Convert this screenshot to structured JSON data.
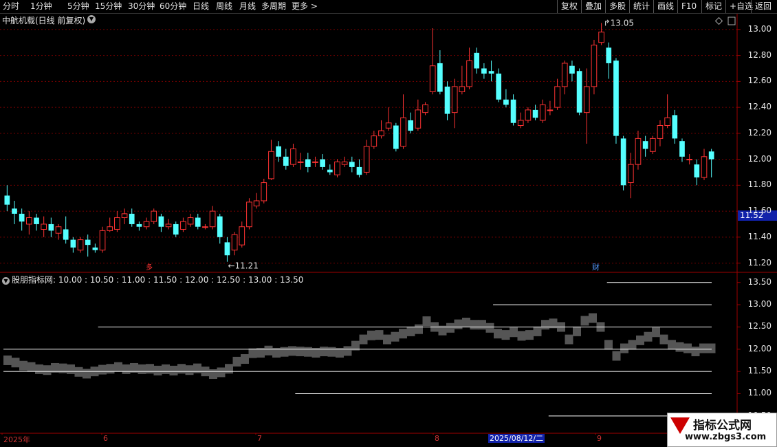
{
  "toolbar": {
    "periods": [
      "分时",
      "1分钟",
      "5分钟",
      "15分钟",
      "30分钟",
      "60分钟",
      "日线",
      "周线",
      "月线",
      "多周期",
      "更多 >"
    ],
    "active_period": "日线",
    "right_buttons": [
      "复权",
      "叠加",
      "多股",
      "统计",
      "画线",
      "F10",
      "标记",
      "+自选",
      "返回"
    ]
  },
  "main_chart": {
    "title": "中航机载(日线 前复权)",
    "current_price": "11.52",
    "price_labels": [
      "13.00",
      "12.80",
      "12.60",
      "12.40",
      "12.20",
      "12.00",
      "11.80",
      "11.60",
      "11.40",
      "11.20"
    ],
    "high_annotation": "13.05",
    "low_annotation": "11.21",
    "event_mark": "财",
    "event_mark2": "多",
    "colors": {
      "up": "#ff3333",
      "down": "#55ffff",
      "background": "#000000",
      "grid": "#7a0000"
    }
  },
  "indicator": {
    "title": "股朋指标网",
    "levels_text": ": 10.00 : 10.50 : 11.00 : 11.50 : 12.00 : 12.50 : 13.00 : 13.50",
    "axis_labels": [
      "13.50",
      "13.00",
      "12.50",
      "12.00",
      "11.50",
      "11.00",
      "10.50"
    ]
  },
  "date_axis": {
    "labels": [
      "2025年",
      "6",
      "7",
      "8",
      "9"
    ],
    "cursor": "2025/08/12/二"
  },
  "watermark": {
    "line1": "指标公式网",
    "line2": "www.zbgs3.com"
  },
  "chart_data": {
    "type": "candlestick",
    "ylim": [
      11.15,
      13.1
    ],
    "candles": [
      [
        11.72,
        11.65,
        11.8,
        11.6
      ],
      [
        11.62,
        11.58,
        11.68,
        11.5
      ],
      [
        11.58,
        11.52,
        11.62,
        11.45
      ],
      [
        11.5,
        11.55,
        11.6,
        11.42
      ],
      [
        11.55,
        11.5,
        11.58,
        11.45
      ],
      [
        11.46,
        11.5,
        11.56,
        11.4
      ],
      [
        11.5,
        11.45,
        11.55,
        11.4
      ],
      [
        11.43,
        11.48,
        11.5,
        11.38
      ],
      [
        11.46,
        11.38,
        11.56,
        11.35
      ],
      [
        11.38,
        11.32,
        11.4,
        11.28
      ],
      [
        11.3,
        11.38,
        11.4,
        11.28
      ],
      [
        11.38,
        11.34,
        11.42,
        11.25
      ],
      [
        11.32,
        11.3,
        11.35,
        11.28
      ],
      [
        11.3,
        11.45,
        11.48,
        11.28
      ],
      [
        11.45,
        11.48,
        11.55,
        11.44
      ],
      [
        11.46,
        11.55,
        11.6,
        11.44
      ],
      [
        11.55,
        11.58,
        11.62,
        11.5
      ],
      [
        11.58,
        11.5,
        11.62,
        11.48
      ],
      [
        11.5,
        11.48,
        11.52,
        11.45
      ],
      [
        11.48,
        11.52,
        11.55,
        11.46
      ],
      [
        11.52,
        11.6,
        11.62,
        11.5
      ],
      [
        11.56,
        11.48,
        11.58,
        11.44
      ],
      [
        11.48,
        11.5,
        11.54,
        11.46
      ],
      [
        11.5,
        11.42,
        11.52,
        11.4
      ],
      [
        11.46,
        11.52,
        11.55,
        11.44
      ],
      [
        11.5,
        11.55,
        11.58,
        11.48
      ],
      [
        11.55,
        11.48,
        11.58,
        11.46
      ],
      [
        11.48,
        11.48,
        11.5,
        11.46
      ],
      [
        11.48,
        11.6,
        11.64,
        11.46
      ],
      [
        11.56,
        11.4,
        11.58,
        11.35
      ],
      [
        11.36,
        11.26,
        11.4,
        11.21
      ],
      [
        11.3,
        11.42,
        11.44,
        11.26
      ],
      [
        11.34,
        11.48,
        11.52,
        11.32
      ],
      [
        11.48,
        11.67,
        11.7,
        11.46
      ],
      [
        11.64,
        11.68,
        11.74,
        11.62
      ],
      [
        11.68,
        11.82,
        11.85,
        11.66
      ],
      [
        11.85,
        12.06,
        12.15,
        11.84
      ],
      [
        12.1,
        12.02,
        12.14,
        11.98
      ],
      [
        12.02,
        11.95,
        12.08,
        11.92
      ],
      [
        11.96,
        12.08,
        12.12,
        11.94
      ],
      [
        11.98,
        11.98,
        12.05,
        11.92
      ],
      [
        12.0,
        11.94,
        12.05,
        11.9
      ],
      [
        11.98,
        11.98,
        12.02,
        11.94
      ],
      [
        12.0,
        11.94,
        12.04,
        11.92
      ],
      [
        11.92,
        11.9,
        11.96,
        11.88
      ],
      [
        11.88,
        11.98,
        12.0,
        11.86
      ],
      [
        11.96,
        11.98,
        12.02,
        11.94
      ],
      [
        11.98,
        11.94,
        12.02,
        11.9
      ],
      [
        11.94,
        11.88,
        12.0,
        11.86
      ],
      [
        11.9,
        12.1,
        12.15,
        11.88
      ],
      [
        12.1,
        12.18,
        12.22,
        12.08
      ],
      [
        12.18,
        12.22,
        12.3,
        12.16
      ],
      [
        12.24,
        12.28,
        12.4,
        12.22
      ],
      [
        12.26,
        12.08,
        12.28,
        12.06
      ],
      [
        12.1,
        12.32,
        12.5,
        12.08
      ],
      [
        12.3,
        12.22,
        12.36,
        12.2
      ],
      [
        12.24,
        12.38,
        12.46,
        12.22
      ],
      [
        12.36,
        12.42,
        12.44,
        12.34
      ],
      [
        12.52,
        12.72,
        13.01,
        12.5
      ],
      [
        12.74,
        12.52,
        12.84,
        12.5
      ],
      [
        12.56,
        12.35,
        12.6,
        12.3
      ],
      [
        12.36,
        12.56,
        12.62,
        12.24
      ],
      [
        12.52,
        12.56,
        12.72,
        12.5
      ],
      [
        12.56,
        12.76,
        12.86,
        12.54
      ],
      [
        12.82,
        12.7,
        12.86,
        12.66
      ],
      [
        12.7,
        12.66,
        12.74,
        12.62
      ],
      [
        12.68,
        12.66,
        12.76,
        12.6
      ],
      [
        12.66,
        12.46,
        12.7,
        12.44
      ],
      [
        12.46,
        12.42,
        12.54,
        12.4
      ],
      [
        12.46,
        12.28,
        12.5,
        12.26
      ],
      [
        12.26,
        12.3,
        12.36,
        12.24
      ],
      [
        12.3,
        12.38,
        12.4,
        12.28
      ],
      [
        12.38,
        12.32,
        12.42,
        12.3
      ],
      [
        12.3,
        12.42,
        12.46,
        12.28
      ],
      [
        12.38,
        12.38,
        12.45,
        12.34
      ],
      [
        12.4,
        12.56,
        12.62,
        12.38
      ],
      [
        12.56,
        12.74,
        12.76,
        12.5
      ],
      [
        12.72,
        12.66,
        12.76,
        12.6
      ],
      [
        12.68,
        12.36,
        12.7,
        12.34
      ],
      [
        12.36,
        12.56,
        12.7,
        12.12
      ],
      [
        12.56,
        12.88,
        12.92,
        12.5
      ],
      [
        12.9,
        12.98,
        13.05,
        12.88
      ],
      [
        12.86,
        12.74,
        12.9,
        12.62
      ],
      [
        12.76,
        12.18,
        12.78,
        12.12
      ],
      [
        12.16,
        11.8,
        12.18,
        11.76
      ],
      [
        11.82,
        11.96,
        12.05,
        11.7
      ],
      [
        11.96,
        12.16,
        12.22,
        11.92
      ],
      [
        12.14,
        12.08,
        12.18,
        12.02
      ],
      [
        12.06,
        12.16,
        12.18,
        12.04
      ],
      [
        12.16,
        12.26,
        12.3,
        12.1
      ],
      [
        12.26,
        12.32,
        12.5,
        12.24
      ],
      [
        12.34,
        12.16,
        12.38,
        12.12
      ],
      [
        12.14,
        12.02,
        12.16,
        11.98
      ],
      [
        12.0,
        12.0,
        12.04,
        11.96
      ],
      [
        11.96,
        11.86,
        12.0,
        11.8
      ],
      [
        11.86,
        12.02,
        12.08,
        11.84
      ],
      [
        12.06,
        12.0,
        12.08,
        11.86
      ]
    ],
    "indicator_steps": [
      11.75,
      11.7,
      11.63,
      11.6,
      11.55,
      11.53,
      11.58,
      11.57,
      11.55,
      11.49,
      11.45,
      11.5,
      11.54,
      11.56,
      11.6,
      11.55,
      11.58,
      11.55,
      11.56,
      11.52,
      11.55,
      11.52,
      11.56,
      11.53,
      11.57,
      11.5,
      11.44,
      11.48,
      11.56,
      11.72,
      11.78,
      11.91,
      11.92,
      11.97,
      11.92,
      11.94,
      11.96,
      11.95,
      11.94,
      11.92,
      11.95,
      11.94,
      11.92,
      11.96,
      12.08,
      12.22,
      12.31,
      12.32,
      12.22,
      12.28,
      12.35,
      12.4,
      12.45,
      12.63,
      12.5,
      12.42,
      12.48,
      12.56,
      12.6,
      12.55,
      12.55,
      12.48,
      12.35,
      12.32,
      12.38,
      12.3,
      12.32,
      12.4,
      12.55,
      12.58,
      12.5,
      12.22,
      12.4,
      12.64,
      12.7,
      12.5,
      12.1,
      11.85,
      12.02,
      12.1,
      12.2,
      12.28,
      12.38,
      12.22,
      12.1,
      12.05,
      12.02,
      11.95,
      12.02,
      12.02
    ],
    "indicator_levels": [
      {
        "value": 13.5,
        "from": 0.848,
        "to": 0.915
      },
      {
        "value": 13.0,
        "from": 0.688,
        "to": 0.915
      },
      {
        "value": 12.5,
        "from": 0.133,
        "to": 0.915
      },
      {
        "value": 12.0,
        "from": 0.0,
        "to": 0.915
      },
      {
        "value": 11.5,
        "from": 0.0,
        "to": 0.915
      },
      {
        "value": 11.0,
        "from": 0.41,
        "to": 0.915
      },
      {
        "value": 10.5,
        "from": 0.766,
        "to": 0.915
      }
    ]
  }
}
